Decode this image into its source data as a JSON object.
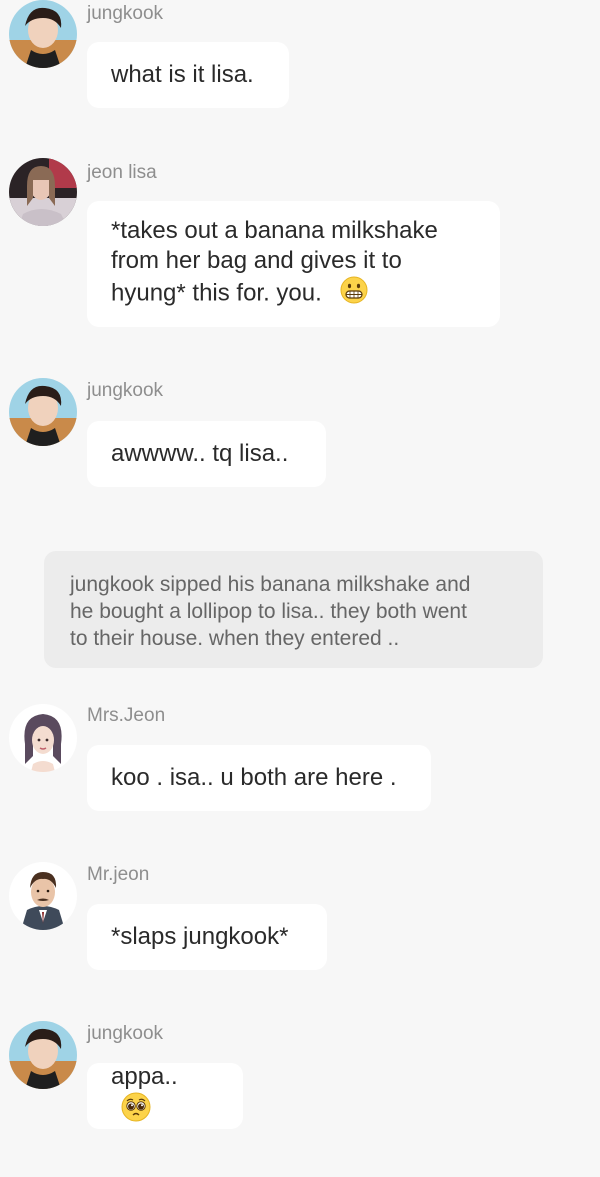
{
  "messages": [
    {
      "sender": "jungkook",
      "avatar_icon": "avatar-jungkook-icon",
      "text": "what is it lisa."
    },
    {
      "sender": "jeon lisa",
      "avatar_icon": "avatar-lisa-icon",
      "lines": [
        "*takes out a banana milkshake",
        "from her bag and gives it to",
        "hyung* this for. you."
      ],
      "emoji": "grinning-face-emoji"
    },
    {
      "sender": "jungkook",
      "avatar_icon": "avatar-jungkook-icon",
      "text": "awwww.. tq lisa.."
    },
    {
      "sender": "Mrs.Jeon",
      "avatar_icon": "avatar-mrs-jeon-icon",
      "text": "koo . isa.. u both are here ."
    },
    {
      "sender": "Mr.jeon",
      "avatar_icon": "avatar-mr-jeon-icon",
      "text": "*slaps jungkook*"
    },
    {
      "sender": "jungkook",
      "avatar_icon": "avatar-jungkook-icon",
      "text": "appa..",
      "emoji": "pleading-face-emoji"
    }
  ],
  "narration": {
    "lines": [
      "jungkook sipped his banana milkshake and",
      "he bought a lollipop to lisa.. they both went",
      "to their house.  when they entered .."
    ]
  },
  "colors": {
    "background": "#f7f7f7",
    "bubble": "#ffffff",
    "narration_bg": "#ececec",
    "sender_text": "#8e8e8e",
    "message_text": "#2a2a2a"
  }
}
